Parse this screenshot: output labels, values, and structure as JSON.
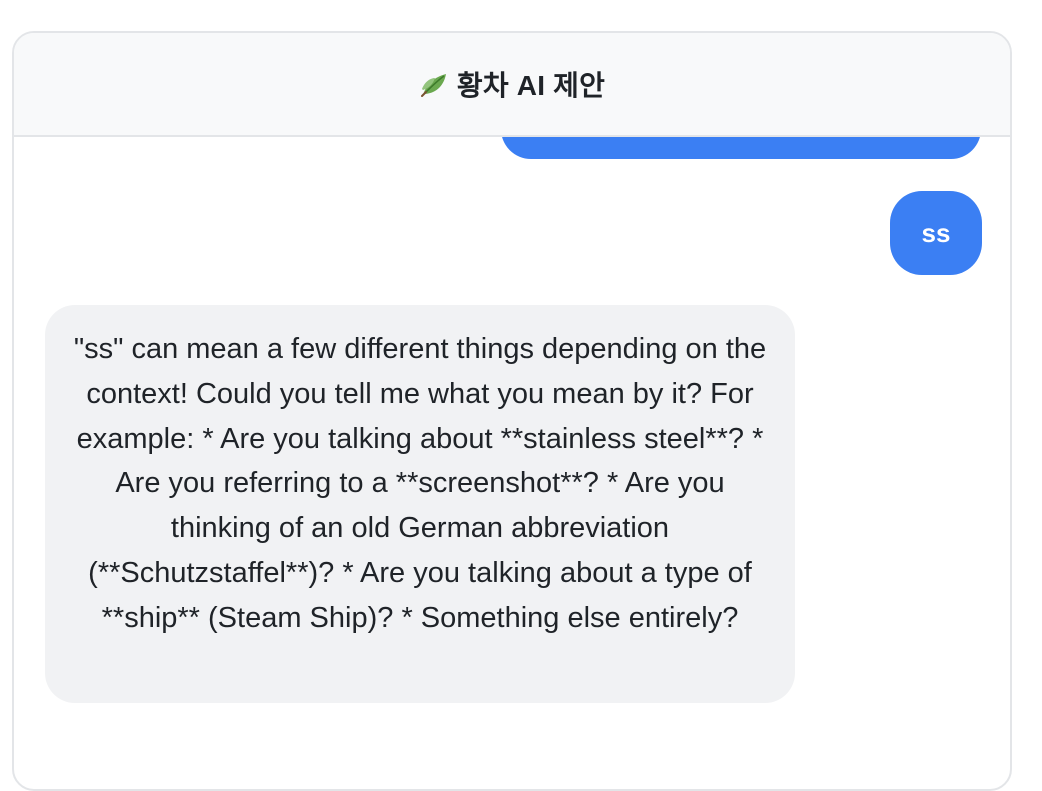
{
  "header": {
    "icon": "leaf-icon",
    "title": "황차 AI 제안"
  },
  "messages": [
    {
      "role": "user",
      "text": ""
    },
    {
      "role": "user",
      "text": "ss"
    },
    {
      "role": "assistant",
      "text": "\"ss\" can mean a few different things depending on the context! Could you tell me what you mean by it? For example: * Are you talking about **stainless steel**? * Are you referring to a **screenshot**? * Are you thinking of an old German abbreviation (**Schutzstaffel**)? * Are you talking about a type of **ship** (Steam Ship)? * Something else entirely?"
    }
  ],
  "colors": {
    "user_bubble": "#3b7ff3",
    "assistant_bubble": "#f1f2f4",
    "header_bg": "#f8f9fa"
  }
}
